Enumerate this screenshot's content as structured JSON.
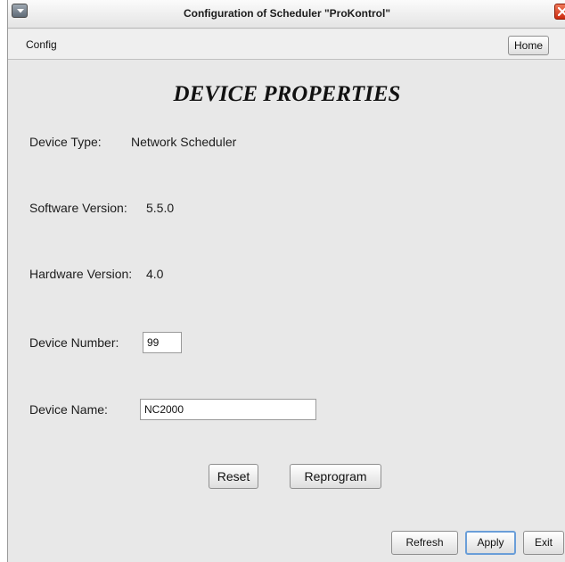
{
  "window": {
    "title": "Configuration of Scheduler \"ProKontrol\""
  },
  "menu": {
    "config": "Config",
    "home": "Home"
  },
  "heading": "DEVICE PROPERTIES",
  "device_type": {
    "label": "Device Type:",
    "value": "Network Scheduler"
  },
  "software_version": {
    "label": "Software Version:",
    "value": "5.5.0"
  },
  "hardware_version": {
    "label": "Hardware Version:",
    "value": "4.0"
  },
  "device_number": {
    "label": "Device Number:",
    "value": "99"
  },
  "device_name": {
    "label": "Device Name:",
    "value": "NC2000"
  },
  "buttons": {
    "reset": "Reset",
    "reprogram": "Reprogram",
    "refresh": "Refresh",
    "apply": "Apply",
    "exit": "Exit"
  },
  "icons": {
    "system_menu": "chevron-down-icon",
    "close": "close-icon"
  },
  "colors": {
    "close": "#d9361a",
    "apply_focus": "#6a9ed8"
  }
}
